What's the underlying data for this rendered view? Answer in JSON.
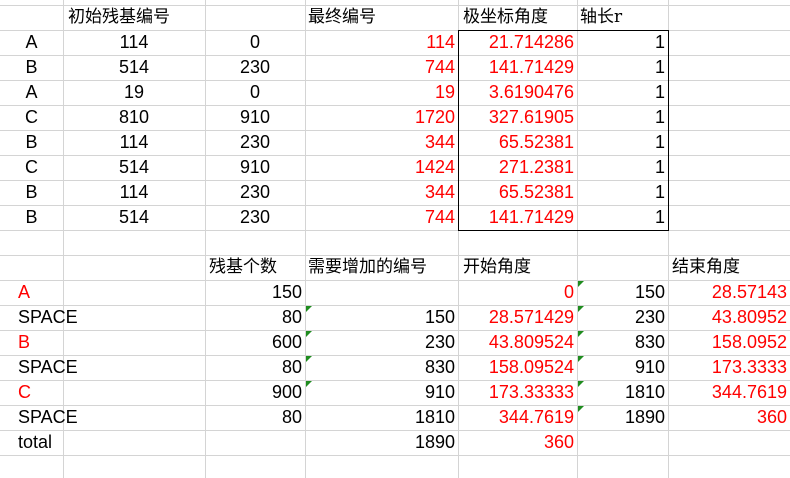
{
  "top": {
    "headers": {
      "initial": "初始残基编号",
      "final": "最终编号",
      "angle": "极坐标角度",
      "axis": "轴长r"
    },
    "rows": [
      {
        "letter": "A",
        "num": "114",
        "offset": "0",
        "final": "114",
        "angle": "21.714286",
        "r": "1"
      },
      {
        "letter": "B",
        "num": "514",
        "offset": "230",
        "final": "744",
        "angle": "141.71429",
        "r": "1"
      },
      {
        "letter": "A",
        "num": "19",
        "offset": "0",
        "final": "19",
        "angle": "3.6190476",
        "r": "1"
      },
      {
        "letter": "C",
        "num": "810",
        "offset": "910",
        "final": "1720",
        "angle": "327.61905",
        "r": "1"
      },
      {
        "letter": "B",
        "num": "114",
        "offset": "230",
        "final": "344",
        "angle": "65.52381",
        "r": "1"
      },
      {
        "letter": "C",
        "num": "514",
        "offset": "910",
        "final": "1424",
        "angle": "271.2381",
        "r": "1"
      },
      {
        "letter": "B",
        "num": "114",
        "offset": "230",
        "final": "344",
        "angle": "65.52381",
        "r": "1"
      },
      {
        "letter": "B",
        "num": "514",
        "offset": "230",
        "final": "744",
        "angle": "141.71429",
        "r": "1"
      }
    ]
  },
  "bottom": {
    "headers": {
      "count": "残基个数",
      "add": "需要增加的编号",
      "start": "开始角度",
      "end": "结束角度"
    },
    "rows": [
      {
        "label": "A",
        "red": true,
        "count": "150",
        "add": "",
        "start": "0",
        "mid": "150",
        "end": "28.57143"
      },
      {
        "label": "SPACE",
        "red": false,
        "count": "80",
        "add": "150",
        "start": "28.571429",
        "mid": "230",
        "end": "43.80952"
      },
      {
        "label": "B",
        "red": true,
        "count": "600",
        "add": "230",
        "start": "43.809524",
        "mid": "830",
        "end": "158.0952"
      },
      {
        "label": "SPACE",
        "red": false,
        "count": "80",
        "add": "830",
        "start": "158.09524",
        "mid": "910",
        "end": "173.3333"
      },
      {
        "label": "C",
        "red": true,
        "count": "900",
        "add": "910",
        "start": "173.33333",
        "mid": "1810",
        "end": "344.7619"
      },
      {
        "label": "SPACE",
        "red": false,
        "count": "80",
        "add": "1810",
        "start": "344.7619",
        "mid": "1890",
        "end": "360"
      },
      {
        "label": "total",
        "red": false,
        "count": "",
        "add": "1890",
        "start": "360",
        "mid": "",
        "end": ""
      }
    ]
  },
  "colors": {
    "accent": "#ff0000",
    "grid": "#d4d4d4",
    "marker": "#1e8c1e"
  }
}
